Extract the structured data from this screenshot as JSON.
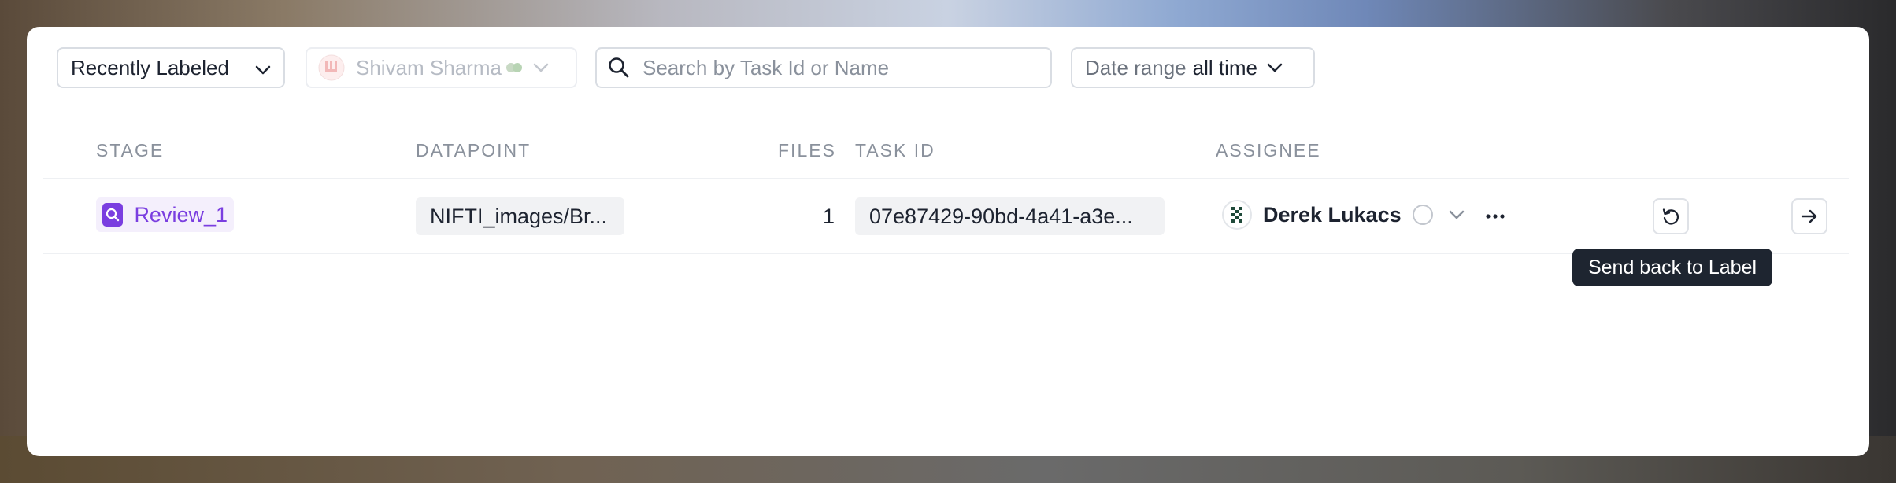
{
  "filters": {
    "sort_label": "Recently Labeled",
    "user_label": "Shivam Sharma",
    "search": {
      "placeholder": "Search by Task Id or Name",
      "value": ""
    },
    "date_range": {
      "prefix": "Date range",
      "value": "all time"
    }
  },
  "table": {
    "columns": [
      "STAGE",
      "DATAPOINT",
      "FILES",
      "TASK ID",
      "ASSIGNEE"
    ],
    "rows": [
      {
        "stage": "Review_1",
        "datapoint": "NIFTI_images/Br...",
        "files": "1",
        "task_id": "07e87429-90bd-4a41-a3e...",
        "assignee": "Derek Lukacs"
      }
    ]
  },
  "tooltip": "Send back to Label",
  "colors": {
    "stage_accent": "#7a3ee0",
    "tooltip_bg": "#1e2530",
    "border": "#d9dde3"
  },
  "icons": [
    "chevron-down-icon",
    "search-icon",
    "magnifier-stage-icon",
    "avatar-pixel-icon",
    "status-circle-icon",
    "undo-icon",
    "more-icon",
    "arrow-right-icon"
  ]
}
